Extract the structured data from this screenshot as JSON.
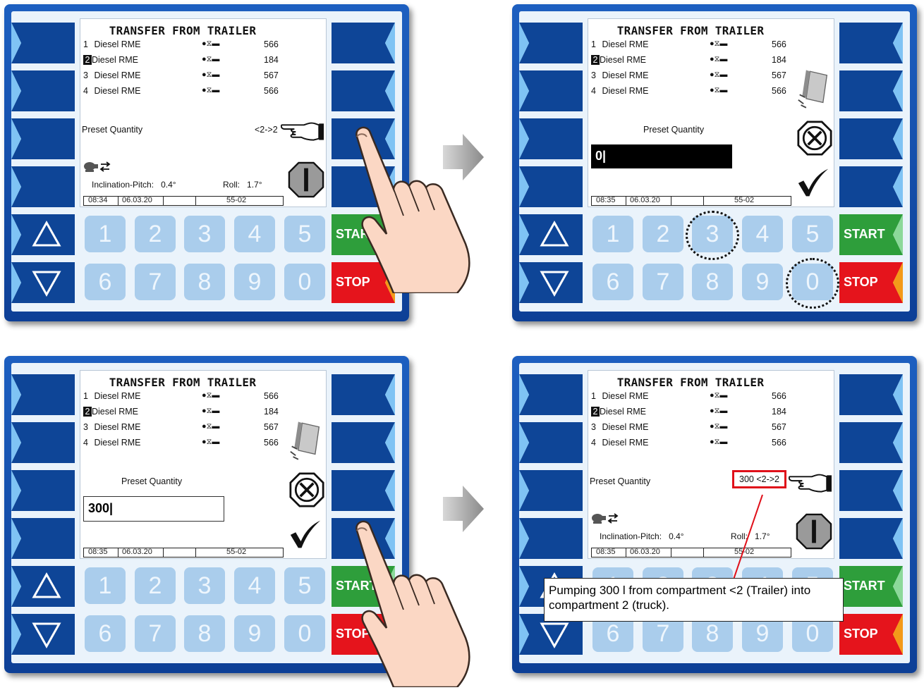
{
  "screen_title": "TRANSFER FROM TRAILER",
  "compartments": [
    {
      "num": "1",
      "product": "Diesel RME",
      "qty": "566",
      "selected": false
    },
    {
      "num": "2",
      "product": "Diesel RME",
      "qty": "184",
      "selected": true
    },
    {
      "num": "3",
      "product": "Diesel RME",
      "qty": "567",
      "selected": false
    },
    {
      "num": "4",
      "product": "Diesel RME",
      "qty": "566",
      "selected": false
    }
  ],
  "pump_icon": "pump-status-icon",
  "preset_label": "Preset Quantity",
  "inclination": {
    "pitch_label": "Inclination-Pitch:",
    "pitch_value": "0.4°",
    "roll_label": "Roll:",
    "roll_value": "1.7°"
  },
  "keypad": [
    "1",
    "2",
    "3",
    "4",
    "5",
    "6",
    "7",
    "8",
    "9",
    "0"
  ],
  "start_label": "START",
  "stop_label": "STOP",
  "panels": {
    "p1": {
      "preset_value": "<2->2",
      "time": "08:34",
      "date": "06.03.20",
      "code": "55-02"
    },
    "p2": {
      "input_value": "0|",
      "time": "08:35",
      "date": "06.03.20",
      "code": "55-02"
    },
    "p3": {
      "input_value": "300|",
      "time": "08:35",
      "date": "06.03.20",
      "code": "55-02"
    },
    "p4": {
      "preset_value": "300 <2->2",
      "time": "08:35",
      "date": "06.03.20",
      "code": "55-02"
    }
  },
  "annotation": "Pumping 300 l from compartment <2 (Trailer) into compartment 2 (truck).",
  "colors": {
    "frame": "#1450b0",
    "softkey": "#0e4597",
    "start": "#2e9e3b",
    "stop": "#e5141c",
    "stop_accent": "#f39a1a",
    "numkey": "#aacdec",
    "highlight": "#e0101a"
  }
}
